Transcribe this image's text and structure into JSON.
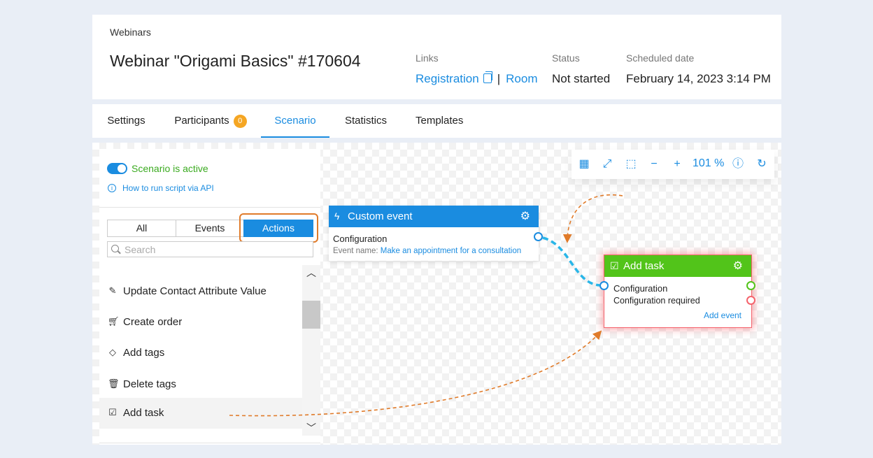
{
  "header": {
    "breadcrumb": "Webinars",
    "title": "Webinar \"Origami Basics\" #170604",
    "links_label": "Links",
    "registration_link": "Registration",
    "separator": "|",
    "room_link": "Room",
    "status_label": "Status",
    "status_value": "Not started",
    "date_label": "Scheduled date",
    "date_value": "February 14, 2023 3:14 PM"
  },
  "tabs": [
    {
      "label": "Settings"
    },
    {
      "label": "Participants",
      "badge": "0"
    },
    {
      "label": "Scenario",
      "active": true
    },
    {
      "label": "Statistics"
    },
    {
      "label": "Templates"
    }
  ],
  "panel": {
    "active_label": "Scenario is active",
    "api_link": "How to run script via API",
    "filters": [
      "All",
      "Events",
      "Actions"
    ],
    "selected_filter": "Actions",
    "search_placeholder": "Search",
    "items": [
      {
        "label": "Update Contact Attribute Value",
        "icon": "edit-icon"
      },
      {
        "label": "Create order",
        "icon": "cart-icon"
      },
      {
        "label": "Add tags",
        "icon": "tag-icon"
      },
      {
        "label": "Delete tags",
        "icon": "trash-icon"
      },
      {
        "label": "Add task",
        "icon": "task-check-icon"
      }
    ]
  },
  "zoombar": {
    "zoom": "101 %",
    "icons": [
      "grid-icon",
      "fullscreen-icon",
      "fit-icon",
      "zoom-out-icon",
      "zoom-in-icon",
      "help-icon",
      "history-icon"
    ]
  },
  "nodes": {
    "custom_event": {
      "title": "Custom event",
      "config_label": "Configuration",
      "event_name_label": "Event name:",
      "event_name_value": "Make an appointment for a consultation",
      "color": "#1a8ce0"
    },
    "add_task": {
      "title": "Add task",
      "config_label": "Configuration",
      "config_status": "Configuration required",
      "add_event_link": "Add event",
      "color": "#52c41a"
    }
  },
  "colors": {
    "accent": "#1a8ce0",
    "success": "#52c41a",
    "annotation": "#e07b2a",
    "badge": "#f5a623",
    "error": "#f5636c"
  }
}
